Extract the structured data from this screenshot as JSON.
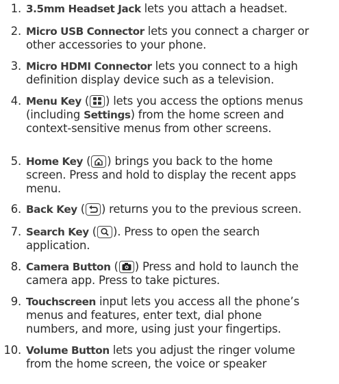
{
  "items": [
    {
      "num": "1.",
      "term": "3.5mm Headset Jack",
      "lines": [
        " lets you attach a headset."
      ]
    },
    {
      "num": "2.",
      "term": "Micro USB Connector",
      "lines": [
        " lets you connect a charger or",
        "other accessories to your phone."
      ]
    },
    {
      "num": "3.",
      "term": "Micro HDMI Connector",
      "lines": [
        " lets you connect to a high",
        "definition display device such as a television."
      ]
    },
    {
      "num": "4.",
      "term": "Menu Key",
      "pre": " (",
      "post": ") lets you access the options menus",
      "icon": "menu-key-icon",
      "lines": [
        "(including ",
        "Settings",
        ") from the home screen and",
        "context-sensitive menus from other screens."
      ]
    },
    {
      "num": "5.",
      "term": "Home Key",
      "pre": " (",
      "post": ") brings you back to the home",
      "icon": "home-key-icon",
      "lines": [
        "screen. Press and hold to display the recent apps",
        "menu."
      ]
    },
    {
      "num": "6.",
      "term": "Back Key",
      "pre": " (",
      "post": ") returns you to the previous screen.",
      "icon": "back-key-icon"
    },
    {
      "num": "7.",
      "term": "Search Key",
      "pre": " (",
      "post": "). Press to open the search",
      "icon": "search-key-icon",
      "lines": [
        "application."
      ]
    },
    {
      "num": "8.",
      "term": "Camera Button",
      "pre": " (",
      "post": ") Press and hold to launch the",
      "icon": "camera-button-icon",
      "lines": [
        "camera app. Press to take pictures."
      ]
    },
    {
      "num": "9.",
      "term": "Touchscreen",
      "lines": [
        " input lets you access all the phone’s",
        "menus and features, enter text, dial phone",
        "numbers, and more, using just your fingertips."
      ]
    },
    {
      "num": "10.",
      "term": "Volume Button",
      "lines": [
        " lets you adjust the ringer volume",
        "from the home screen, the voice or speaker"
      ]
    }
  ]
}
